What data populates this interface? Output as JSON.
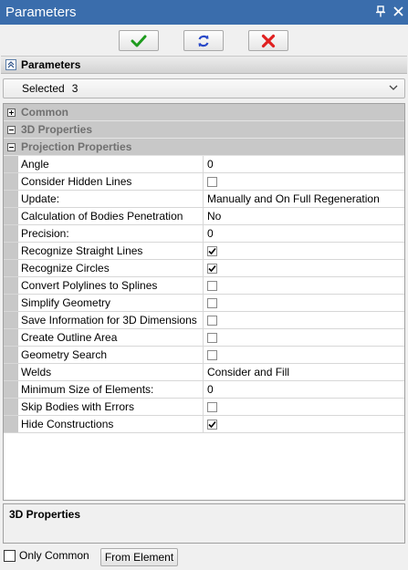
{
  "window": {
    "title": "Parameters",
    "pin_icon": "pin-icon",
    "close_icon": "close-icon"
  },
  "toolbar": {
    "buttons": [
      {
        "name": "ok",
        "icon": "checkmark-icon",
        "color": "#1e9b1e"
      },
      {
        "name": "refresh",
        "icon": "refresh-icon",
        "color": "#2848c8"
      },
      {
        "name": "cancel",
        "icon": "cross-icon",
        "color": "#e02020"
      }
    ]
  },
  "panel": {
    "header": "Parameters"
  },
  "selection": {
    "label": "Selected",
    "count": "3"
  },
  "groups": [
    {
      "label": "Common",
      "expanded": false
    },
    {
      "label": "3D Properties",
      "expanded": true
    },
    {
      "label": "Projection Properties",
      "expanded": true
    }
  ],
  "properties": [
    {
      "name": "Angle",
      "type": "text",
      "value": "0"
    },
    {
      "name": "Consider Hidden Lines",
      "type": "checkbox",
      "checked": false
    },
    {
      "name": "Update:",
      "type": "text",
      "value": "Manually and On Full Regeneration"
    },
    {
      "name": "Calculation of Bodies Penetration",
      "type": "text",
      "value": "No"
    },
    {
      "name": "Precision:",
      "type": "text",
      "value": "0"
    },
    {
      "name": "Recognize Straight Lines",
      "type": "checkbox",
      "checked": true
    },
    {
      "name": "Recognize Circles",
      "type": "checkbox",
      "checked": true
    },
    {
      "name": "Convert Polylines to Splines",
      "type": "checkbox",
      "checked": false
    },
    {
      "name": "Simplify Geometry",
      "type": "checkbox",
      "checked": false
    },
    {
      "name": "Save Information for 3D Dimensions",
      "type": "checkbox",
      "checked": false
    },
    {
      "name": "Create Outline Area",
      "type": "checkbox",
      "checked": false
    },
    {
      "name": "Geometry Search",
      "type": "checkbox",
      "checked": false
    },
    {
      "name": "Welds",
      "type": "text",
      "value": "Consider and Fill"
    },
    {
      "name": "Minimum Size of Elements:",
      "type": "text",
      "value": "0"
    },
    {
      "name": "Skip Bodies with Errors",
      "type": "checkbox",
      "checked": false
    },
    {
      "name": "Hide Constructions",
      "type": "checkbox",
      "checked": true
    }
  ],
  "description": {
    "title": "3D Properties"
  },
  "footer": {
    "only_common_label": "Only Common",
    "only_common_checked": false,
    "from_element_label": "From Element"
  }
}
